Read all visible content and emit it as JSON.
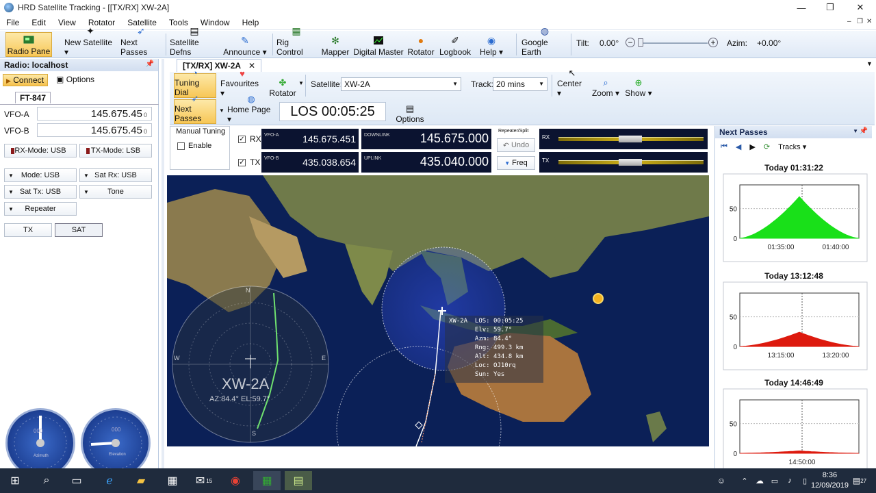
{
  "window": {
    "title": "HRD Satellite Tracking - [[TX/RX]  XW-2A]",
    "controls": {
      "minimize": "—",
      "maximize": "❐",
      "close": "✕"
    }
  },
  "menu": [
    "File",
    "Edit",
    "View",
    "Rotator",
    "Satellite",
    "Tools",
    "Window",
    "Help"
  ],
  "toolbar": {
    "radio_pane": "Radio Pane",
    "new_satellite": "New Satellite",
    "next_passes": "Next Passes",
    "satellite_defns": "Satellite Defns",
    "announce": "Announce",
    "rig_control": "Rig Control",
    "mapper": "Mapper",
    "digital_master": "Digital Master",
    "rotator": "Rotator",
    "logbook": "Logbook",
    "help": "Help",
    "google_earth": "Google Earth",
    "tilt_label": "Tilt:",
    "tilt_value": "0.00°",
    "azim_label": "Azim:",
    "azim_value": "+0.00°"
  },
  "radio_panel": {
    "header": "Radio: localhost",
    "connect": "Connect",
    "options": "Options",
    "rig_tab": "FT-847",
    "vfo_a_label": "VFO-A",
    "vfo_a_value": "145.675.45",
    "vfo_a_sub": "0",
    "vfo_b_label": "VFO-B",
    "vfo_b_value": "145.675.45",
    "vfo_b_sub": "0",
    "rx_mode": "RX-Mode: USB",
    "tx_mode": "TX-Mode: LSB",
    "mode": "Mode: USB",
    "sat_rx": "Sat Rx: USB",
    "sat_tx": "Sat Tx: USB",
    "tone": "Tone",
    "repeater": "Repeater",
    "tx": "TX",
    "sat": "SAT",
    "gauge_az_label": "Azimuth",
    "gauge_el_label": "Elevation",
    "gauge_az_value": "000",
    "gauge_el_value": "000"
  },
  "doc": {
    "tab": "[TX/RX]  XW-2A",
    "tuning_dial": "Tuning Dial",
    "favourites": "Favourites",
    "rotator": "Rotator",
    "satellite_label": "Satellite:",
    "satellite_value": "XW-2A",
    "track_label": "Track:",
    "track_value": "20 mins",
    "center": "Center",
    "zoom": "Zoom",
    "show": "Show",
    "next_passes": "Next Passes",
    "home_page": "Home Page",
    "los": "LOS 00:05:25",
    "options": "Options"
  },
  "tuning": {
    "manual_tuning": "Manual Tuning",
    "enable": "Enable",
    "rx": "RX",
    "tx": "TX",
    "vfo_a": "VFO-A",
    "vfo_a_value": "145.675.451",
    "vfo_b": "VFO-B",
    "vfo_b_value": "435.038.654",
    "downlink": "DOWNLINK",
    "downlink_value": "145.675.000",
    "uplink": "UPLINK",
    "uplink_value": "435.040.000",
    "repeater_split": "Repeater/Split",
    "undo": "Undo",
    "freq": "Freq",
    "meter_rx": "RX",
    "meter_tx": "TX"
  },
  "map": {
    "sat_name": "XW-2A",
    "info": [
      "XW-2A  LOS: 00:05:25",
      "       Elv: 59.7°",
      "       Azm: 84.4°",
      "       Rng: 499.3 km",
      "       Alt: 434.8 km",
      "       Loc: OJ10rq",
      "       Sun: Yes"
    ],
    "radar_name": "XW-2A",
    "radar_azel": "AZ:84.4°   EL:59.7°",
    "compass": {
      "n": "N",
      "s": "S",
      "e": "E",
      "w": "W"
    }
  },
  "next_passes": {
    "header": "Next Passes",
    "tracks": "Tracks",
    "passes": [
      {
        "title": "Today 01:31:22",
        "ticks": [
          "01:35:00",
          "01:40:00"
        ],
        "y_ticks": [
          "50",
          "0"
        ],
        "color": "#19e019",
        "peak": 70
      },
      {
        "title": "Today 13:12:48",
        "ticks": [
          "13:15:00",
          "13:20:00"
        ],
        "y_ticks": [
          "50",
          "0"
        ],
        "color": "#dd1a0e",
        "peak": 24
      },
      {
        "title": "Today 14:46:49",
        "ticks": [
          "14:50:00"
        ],
        "y_ticks": [
          "50",
          "0"
        ],
        "color": "#dd1a0e",
        "peak": 4
      }
    ]
  },
  "taskbar": {
    "clock_time": "8:36",
    "clock_date": "12/09/2019",
    "mail_badge": "15",
    "notif_badge": "27"
  }
}
